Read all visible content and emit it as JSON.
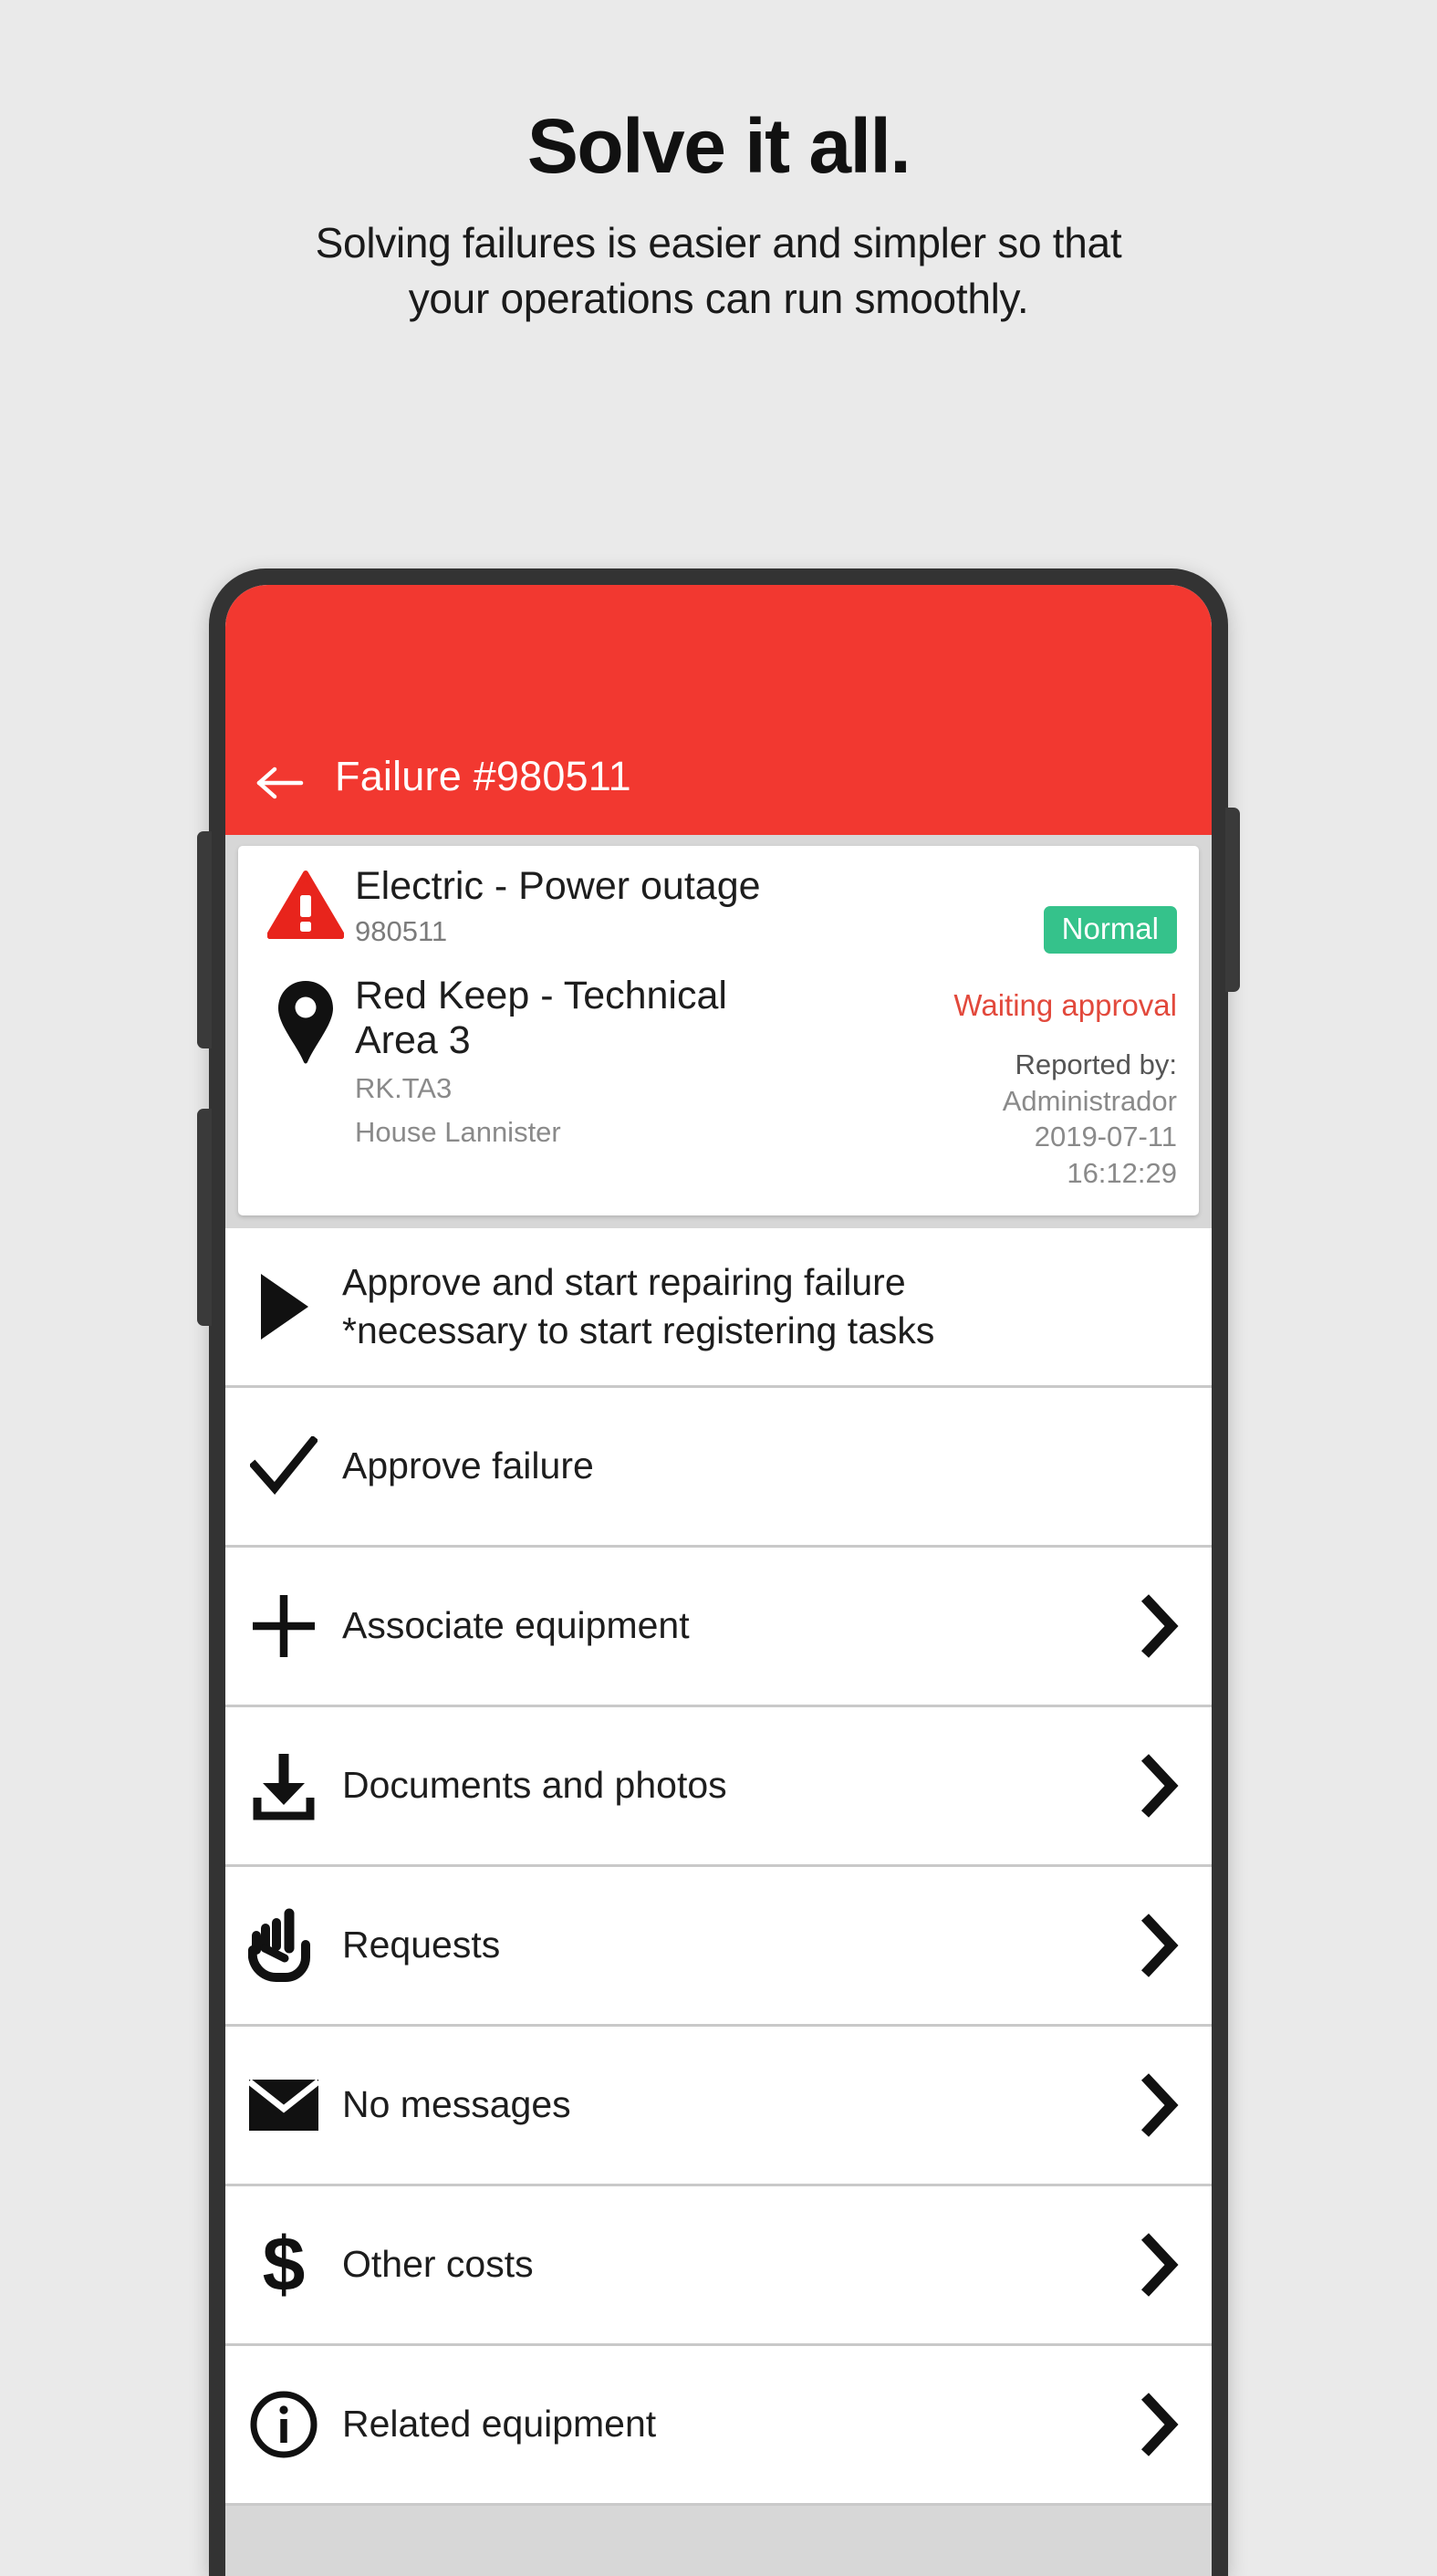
{
  "promo": {
    "title": "Solve it all.",
    "subtitle_line1": "Solving failures is easier and simpler so that",
    "subtitle_line2": "your operations can run smoothly."
  },
  "colors": {
    "background": "#eaeaea",
    "accent_red": "#f23830",
    "badge_green": "#35c28b",
    "status_red": "#e2493c",
    "screen_gray": "#d7d7d7",
    "frame_dark": "#333333"
  },
  "appbar": {
    "back_icon": "arrow-left-icon",
    "title": "Failure #980511"
  },
  "info_card": {
    "warning_icon": "warning-triangle-icon",
    "failure_title": "Electric - Power outage",
    "failure_code": "980511",
    "priority_badge": "Normal",
    "status": "Waiting approval",
    "location_icon": "map-pin-icon",
    "location_title": "Red Keep - Technical Area 3",
    "location_code": "RK.TA3",
    "location_owner": "House Lannister",
    "reported_by_label": "Reported by:",
    "reported_by_name": "Administrador",
    "reported_date": "2019-07-11",
    "reported_time": "16:12:29"
  },
  "actions": [
    {
      "icon": "play-triangle-icon",
      "label_line1": "Approve and start repairing failure",
      "label_line2": "*necessary to start registering tasks",
      "chevron": false
    },
    {
      "icon": "check-icon",
      "label_line1": "Approve failure",
      "label_line2": "",
      "chevron": false
    },
    {
      "icon": "plus-icon",
      "label_line1": "Associate equipment",
      "label_line2": "",
      "chevron": true
    },
    {
      "icon": "download-icon",
      "label_line1": "Documents and photos",
      "label_line2": "",
      "chevron": true
    },
    {
      "icon": "pointing-hand-icon",
      "label_line1": "Requests",
      "label_line2": "",
      "chevron": true
    },
    {
      "icon": "envelope-icon",
      "label_line1": "No messages",
      "label_line2": "",
      "chevron": true
    },
    {
      "icon": "dollar-icon",
      "label_line1": "Other costs",
      "label_line2": "",
      "chevron": true
    },
    {
      "icon": "info-circle-icon",
      "label_line1": "Related equipment",
      "label_line2": "",
      "chevron": true
    }
  ]
}
